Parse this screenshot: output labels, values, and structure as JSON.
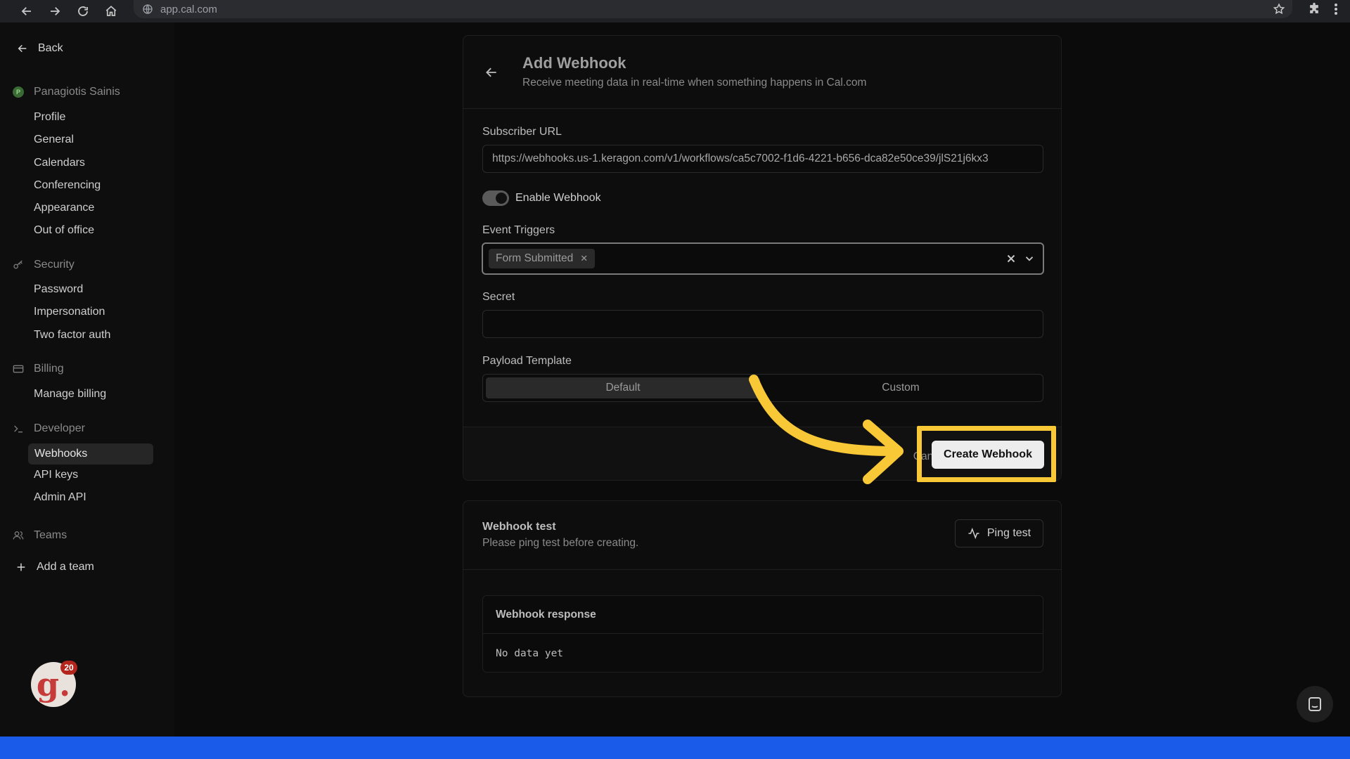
{
  "browser": {
    "url": "app.cal.com"
  },
  "sidebar": {
    "back_label": "Back",
    "user_initial": "P",
    "user_name": "Panagiotis Sainis",
    "account_items": [
      "Profile",
      "General",
      "Calendars",
      "Conferencing",
      "Appearance",
      "Out of office"
    ],
    "security_label": "Security",
    "security_items": [
      "Password",
      "Impersonation",
      "Two factor auth"
    ],
    "billing_label": "Billing",
    "billing_items": [
      "Manage billing"
    ],
    "developer_label": "Developer",
    "developer_items": [
      "Webhooks",
      "API keys",
      "Admin API"
    ],
    "active_item": "Webhooks",
    "teams_label": "Teams",
    "add_team_label": "Add a team",
    "gravatar_letter": "g.",
    "notification_count": "20"
  },
  "form": {
    "title": "Add Webhook",
    "subtitle": "Receive meeting data in real-time when something happens in Cal.com",
    "subscriber_url_label": "Subscriber URL",
    "subscriber_url_value": "https://webhooks.us-1.keragon.com/v1/workflows/ca5c7002-f1d6-4221-b656-dca82e50ce39/jlS21j6kx3",
    "enable_label": "Enable Webhook",
    "enable_on": true,
    "event_triggers_label": "Event Triggers",
    "event_triggers": [
      "Form Submitted"
    ],
    "secret_label": "Secret",
    "secret_value": "",
    "payload_label": "Payload Template",
    "payload_options": [
      "Default",
      "Custom"
    ],
    "payload_selected": "Default",
    "cancel_label": "Cancel",
    "create_label": "Create Webhook"
  },
  "test": {
    "title": "Webhook test",
    "subtitle": "Please ping test before creating.",
    "ping_label": "Ping test",
    "response_title": "Webhook response",
    "response_body": "No data yet"
  },
  "colors": {
    "annotation": "#f8c837",
    "bottom_bar": "#1a5bea"
  }
}
